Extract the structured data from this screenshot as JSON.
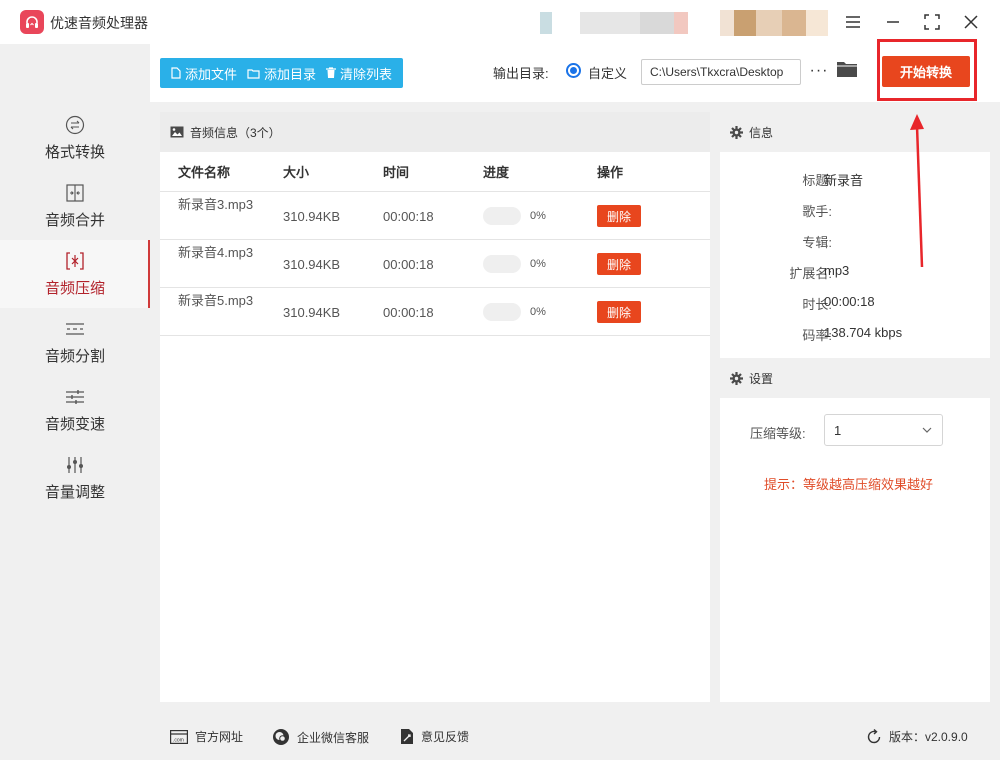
{
  "app": {
    "title": "优速音频处理器"
  },
  "sidebar": {
    "items": [
      {
        "label": "格式转换",
        "icon": "swap-icon"
      },
      {
        "label": "音频合并",
        "icon": "merge-icon"
      },
      {
        "label": "音频压缩",
        "icon": "compress-icon",
        "active": true
      },
      {
        "label": "音频分割",
        "icon": "split-icon"
      },
      {
        "label": "音频变速",
        "icon": "speed-icon"
      },
      {
        "label": "音量调整",
        "icon": "volume-icon"
      }
    ]
  },
  "toolbar": {
    "add_file": "添加文件",
    "add_folder": "添加目录",
    "clear_list": "清除列表",
    "output_label": "输出目录:",
    "radio_label": "自定义",
    "output_path": "C:\\Users\\Tkxcra\\Desktop",
    "more": "···",
    "start": "开始转换"
  },
  "files": {
    "header": "音频信息（3个）",
    "columns": {
      "name": "文件名称",
      "size": "大小",
      "time": "时间",
      "progress": "进度",
      "action": "操作"
    },
    "rows": [
      {
        "name": "新录音3.mp3",
        "size": "310.94KB",
        "time": "00:00:18",
        "progress": "0%",
        "progress_value": 0,
        "action": "删除"
      },
      {
        "name": "新录音4.mp3",
        "size": "310.94KB",
        "time": "00:00:18",
        "progress": "0%",
        "progress_value": 0,
        "action": "删除"
      },
      {
        "name": "新录音5.mp3",
        "size": "310.94KB",
        "time": "00:00:18",
        "progress": "0%",
        "progress_value": 0,
        "action": "删除"
      }
    ]
  },
  "info": {
    "header": "信息",
    "fields": [
      {
        "key": "标题:",
        "value": "新录音"
      },
      {
        "key": "歌手:",
        "value": ""
      },
      {
        "key": "专辑:",
        "value": ""
      },
      {
        "key": "扩展名:",
        "value": "mp3"
      },
      {
        "key": "时长:",
        "value": "00:00:18"
      },
      {
        "key": "码率:",
        "value": "138.704 kbps"
      }
    ]
  },
  "settings": {
    "header": "设置",
    "level_label": "压缩等级:",
    "level_value": "1",
    "tip": "提示：等级越高压缩效果越好"
  },
  "footer": {
    "website": "官方网址",
    "wechat": "企业微信客服",
    "feedback": "意见反馈",
    "version": "版本：v2.0.9.0"
  },
  "colors": {
    "accent": "#e8461e",
    "toolbar_blue": "#2ab0e8",
    "active_red": "#b2222b",
    "highlight": "#e8262b"
  }
}
